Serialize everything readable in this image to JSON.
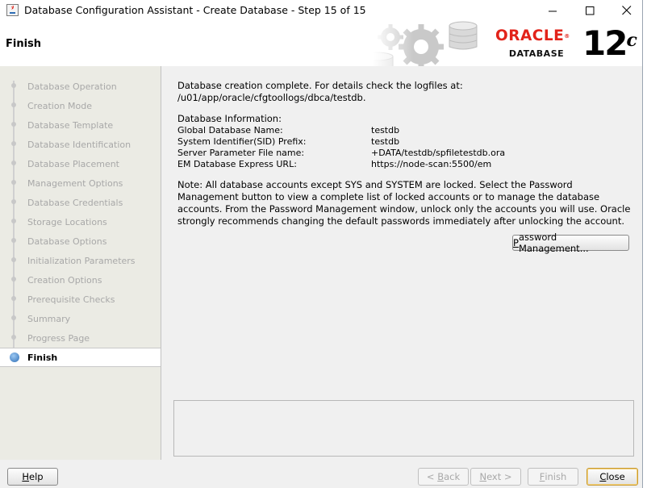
{
  "window": {
    "title": "Database Configuration Assistant - Create Database - Step 15 of 15",
    "controls": [
      "minimize-icon",
      "maximize-icon",
      "close-icon"
    ]
  },
  "header": {
    "title": "Finish",
    "brand": {
      "oracle": "ORACLE",
      "registered": "®",
      "database": "DATABASE",
      "version": "12",
      "version_suffix": "c"
    }
  },
  "sidebar": {
    "items": [
      {
        "label": "Database Operation",
        "state": "done"
      },
      {
        "label": "Creation Mode",
        "state": "done"
      },
      {
        "label": "Database Template",
        "state": "done"
      },
      {
        "label": "Database Identification",
        "state": "done"
      },
      {
        "label": "Database Placement",
        "state": "done"
      },
      {
        "label": "Management Options",
        "state": "done"
      },
      {
        "label": "Database Credentials",
        "state": "done"
      },
      {
        "label": "Storage Locations",
        "state": "done"
      },
      {
        "label": "Database Options",
        "state": "done"
      },
      {
        "label": "Initialization Parameters",
        "state": "done"
      },
      {
        "label": "Creation Options",
        "state": "done"
      },
      {
        "label": "Prerequisite Checks",
        "state": "done"
      },
      {
        "label": "Summary",
        "state": "done"
      },
      {
        "label": "Progress Page",
        "state": "done"
      },
      {
        "label": "Finish",
        "state": "active"
      }
    ]
  },
  "main": {
    "completion_line1": "Database creation complete. For details check the logfiles at:",
    "completion_line2": " /u01/app/oracle/cfgtoollogs/dbca/testdb.",
    "info_heading": "Database Information:",
    "info": [
      {
        "key": "Global Database Name:",
        "value": "testdb"
      },
      {
        "key": "System Identifier(SID) Prefix:",
        "value": "testdb"
      },
      {
        "key": "Server Parameter File name:",
        "value": "+DATA/testdb/spfiletestdb.ora"
      },
      {
        "key": "EM Database Express URL:",
        "value": "https://node-scan:5500/em"
      }
    ],
    "note": "Note: All database accounts except SYS and SYSTEM are locked. Select the Password Management button to view a complete list of locked accounts or to manage the database accounts. From the Password Management window, unlock only the accounts you will use. Oracle strongly recommends changing the default passwords immediately after unlocking the account.",
    "password_button": {
      "label_pre": "",
      "mnemonic": "P",
      "label_post": "assword Management..."
    }
  },
  "footer": {
    "help": {
      "mnemonic": "H",
      "label_post": "elp"
    },
    "back": {
      "pre": "< ",
      "mnemonic": "B",
      "post": "ack"
    },
    "next": {
      "mnemonic": "N",
      "post": "ext >"
    },
    "finish": {
      "mnemonic": "F",
      "post": "inish"
    },
    "close": {
      "mnemonic": "C",
      "post": "lose"
    }
  }
}
